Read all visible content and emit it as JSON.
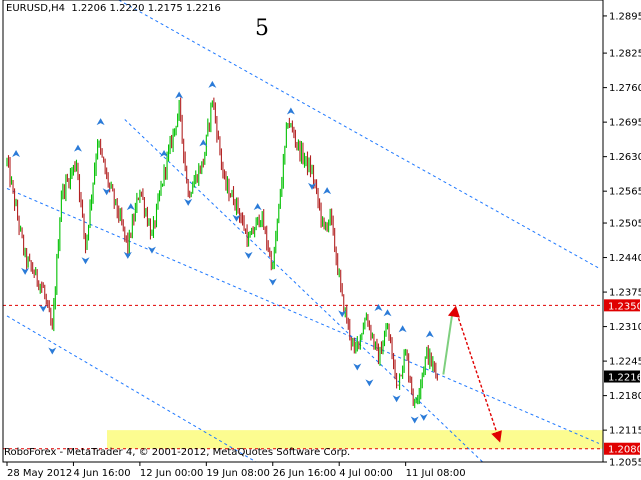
{
  "header": {
    "symbol": "EURUSD,H4",
    "ohlc": "1.2206 1.2220 1.2175 1.2216"
  },
  "annotation": {
    "wave_label": "5"
  },
  "footer": {
    "copyright": "RoboForex - MetaTrader 4, © 2001-2012, MetaQuotes Software Corp."
  },
  "colors": {
    "background": "#ffffff",
    "bull_candle": "#00c000",
    "bear_candle": "#b22222",
    "channel": "#1e78ff",
    "fractal": "#2b7bd8",
    "resistance": "#e00000",
    "forecast_up": "#7ecf7e",
    "forecast_down": "#e00000",
    "target_zone": "#fcfc90",
    "label_bg": "#e00000",
    "current_bg": "#000000"
  },
  "chart_data": {
    "type": "candlestick",
    "symbol": "EURUSD",
    "timeframe": "H4",
    "y_range": [
      1.2055,
      1.2925
    ],
    "y_ticks": [
      "1.2895",
      "1.2825",
      "1.2760",
      "1.2695",
      "1.2630",
      "1.2565",
      "1.2505",
      "1.2440",
      "1.2375",
      "1.2310",
      "1.2245",
      "1.2180",
      "1.2115",
      "1.2055"
    ],
    "x_ticks": [
      "28 May 2012",
      "4 Jun 16:00",
      "12 Jun 00:00",
      "19 Jun 08:00",
      "26 Jun 16:00",
      "4 Jul 00:00",
      "11 Jul 08:00"
    ],
    "x_tick_bars": [
      0,
      44,
      88,
      132,
      176,
      220,
      264
    ],
    "price_labels": {
      "resistance": "1.2350",
      "current": "1.2216",
      "target": "1.2080"
    },
    "levels": {
      "resistance": 1.235,
      "current": 1.2216,
      "target": 1.208
    },
    "target_zone": [
      1.208,
      1.2115
    ],
    "path": [
      [
        0,
        1.262
      ],
      [
        12,
        1.244
      ],
      [
        24,
        1.238
      ],
      [
        30,
        1.23
      ],
      [
        36,
        1.256
      ],
      [
        46,
        1.262
      ],
      [
        52,
        1.246
      ],
      [
        60,
        1.266
      ],
      [
        66,
        1.259
      ],
      [
        74,
        1.252
      ],
      [
        80,
        1.246
      ],
      [
        88,
        1.257
      ],
      [
        96,
        1.248
      ],
      [
        104,
        1.26
      ],
      [
        114,
        1.272
      ],
      [
        120,
        1.256
      ],
      [
        130,
        1.262
      ],
      [
        136,
        1.274
      ],
      [
        144,
        1.258
      ],
      [
        152,
        1.254
      ],
      [
        160,
        1.247
      ],
      [
        168,
        1.252
      ],
      [
        176,
        1.242
      ],
      [
        186,
        1.27
      ],
      [
        194,
        1.264
      ],
      [
        202,
        1.26
      ],
      [
        210,
        1.249
      ],
      [
        214,
        1.252
      ],
      [
        222,
        1.236
      ],
      [
        230,
        1.226
      ],
      [
        238,
        1.233
      ],
      [
        246,
        1.225
      ],
      [
        252,
        1.231
      ],
      [
        258,
        1.22
      ],
      [
        264,
        1.226
      ],
      [
        270,
        1.216
      ],
      [
        278,
        1.226
      ],
      [
        285,
        1.2216
      ]
    ],
    "fractals_up": [
      [
        6,
        1.262
      ],
      [
        47,
        1.263
      ],
      [
        62,
        1.268
      ],
      [
        82,
        1.252
      ],
      [
        104,
        1.262
      ],
      [
        114,
        1.273
      ],
      [
        130,
        1.264
      ],
      [
        136,
        1.275
      ],
      [
        166,
        1.252
      ],
      [
        188,
        1.27
      ],
      [
        212,
        1.255
      ],
      [
        246,
        1.233
      ],
      [
        252,
        1.232
      ],
      [
        262,
        1.229
      ],
      [
        280,
        1.228
      ]
    ],
    "fractals_down": [
      [
        12,
        1.243
      ],
      [
        24,
        1.236
      ],
      [
        30,
        1.228
      ],
      [
        52,
        1.245
      ],
      [
        66,
        1.258
      ],
      [
        80,
        1.246
      ],
      [
        96,
        1.247
      ],
      [
        120,
        1.256
      ],
      [
        152,
        1.253
      ],
      [
        160,
        1.246
      ],
      [
        176,
        1.241
      ],
      [
        202,
        1.259
      ],
      [
        222,
        1.235
      ],
      [
        232,
        1.225
      ],
      [
        240,
        1.222
      ],
      [
        258,
        1.219
      ],
      [
        270,
        1.215
      ],
      [
        276,
        1.2155
      ]
    ],
    "channels": [
      {
        "from": [
          74,
          1.2925
        ],
        "to": [
          392,
          1.242
        ]
      },
      {
        "from": [
          0,
          1.257
        ],
        "to": [
          392,
          1.209
        ]
      },
      {
        "from": [
          78,
          1.27
        ],
        "to": [
          315,
          1.2055
        ]
      },
      {
        "from": [
          0,
          1.233
        ],
        "to": [
          165,
          1.2055
        ]
      }
    ],
    "forecast": [
      [
        285,
        1.2216
      ],
      [
        296,
        1.2342
      ],
      [
        326,
        1.2089
      ]
    ]
  }
}
